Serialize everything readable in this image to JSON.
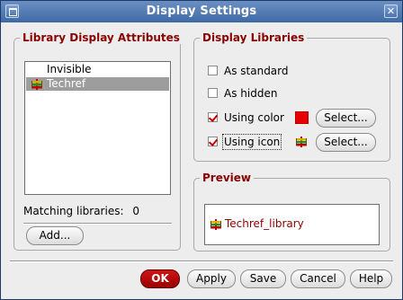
{
  "window": {
    "title": "Display Settings",
    "menu_icon": "window-menu-icon",
    "close_glyph": "✕"
  },
  "library_attributes": {
    "title": "Library Display Attributes",
    "items": [
      {
        "label": "Invisible",
        "icon": "",
        "selected": false
      },
      {
        "label": "Techref",
        "icon": "library-icon",
        "selected": true
      }
    ],
    "matching_label": "Matching libraries:",
    "matching_count": "0",
    "add_label": "Add..."
  },
  "display_libraries": {
    "title": "Display Libraries",
    "as_standard": {
      "label": "As standard",
      "checked": false
    },
    "as_hidden": {
      "label": "As hidden",
      "checked": false
    },
    "using_color": {
      "label": "Using color",
      "checked": true,
      "color": "#e80000",
      "select_label": "Select..."
    },
    "using_icon": {
      "label": "Using icon",
      "checked": true,
      "icon": "library-icon",
      "select_label": "Select..."
    }
  },
  "preview": {
    "title": "Preview",
    "text": "Techref_library",
    "icon": "library-icon"
  },
  "buttons": {
    "ok": "OK",
    "apply": "Apply",
    "save": "Save",
    "cancel": "Cancel",
    "help": "Help"
  }
}
